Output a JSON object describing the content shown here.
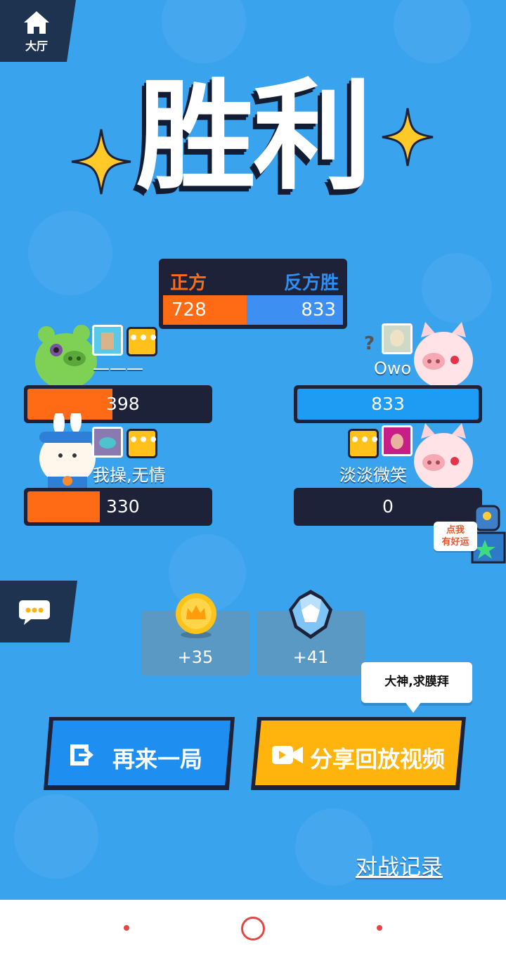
{
  "home_button": {
    "label": "大厅",
    "icon": "home-icon"
  },
  "title": "胜利",
  "scoreboard": {
    "team_a_label": "正方",
    "team_b_label": "反方胜",
    "team_a_score": "728",
    "team_b_score": "833",
    "team_a_share": 0.466
  },
  "players_left": [
    {
      "name": "———",
      "score": "398",
      "fill": 0.47,
      "color": "#ff6a14",
      "mascot": "green-pig"
    },
    {
      "name": "我操,无情",
      "score": "330",
      "fill": 0.4,
      "color": "#ff6a14",
      "mascot": "rabbit"
    }
  ],
  "players_right": [
    {
      "name": "Owo",
      "score": "833",
      "fill": 1.0,
      "color": "#1e9bf2",
      "mascot": "pink-pig"
    },
    {
      "name": "淡淡微笑",
      "score": "0",
      "fill": 0.0,
      "color": "#1e9bf2",
      "mascot": "pink-pig"
    }
  ],
  "chat_button": {
    "icon": "chat-bubble-icon"
  },
  "lucky_box": {
    "label_line1": "点我",
    "label_line2": "有好运"
  },
  "rewards": [
    {
      "icon": "crown-coin-icon",
      "amount": "+35"
    },
    {
      "icon": "diamond-icon",
      "amount": "+41"
    }
  ],
  "speech_bubble": "大神,求膜拜",
  "buttons": {
    "replay": {
      "label": "再来一局",
      "icon": "exit-arrow-icon",
      "color": "#1e8ff0"
    },
    "share": {
      "label": "分享回放视频",
      "icon": "video-camera-icon",
      "color": "#ffb30d"
    }
  },
  "record_link": "对战记录",
  "colors": {
    "background": "#3aa3ee",
    "dark": "#1e2238",
    "orange": "#ff6a14",
    "blue": "#3e8ff2"
  }
}
